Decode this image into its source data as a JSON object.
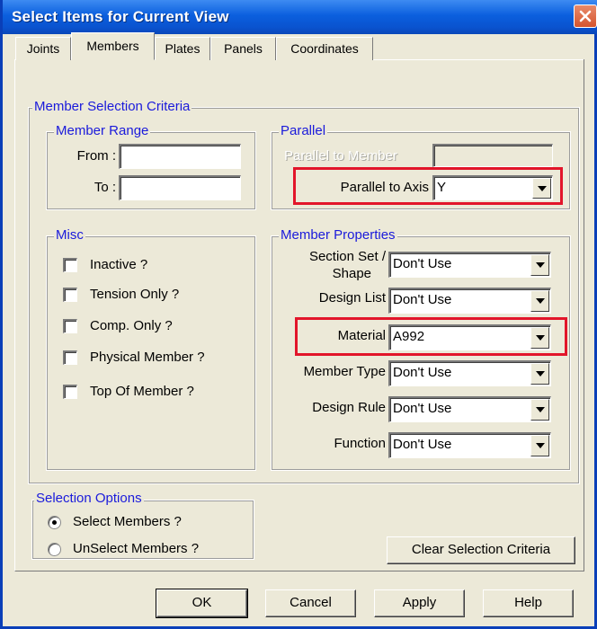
{
  "window": {
    "title": "Select Items for Current View"
  },
  "tabs": [
    {
      "label": "Joints",
      "active": false
    },
    {
      "label": "Members",
      "active": true
    },
    {
      "label": "Plates",
      "active": false
    },
    {
      "label": "Panels",
      "active": false
    },
    {
      "label": "Coordinates",
      "active": false
    }
  ],
  "criteria": {
    "title": "Member Selection Criteria",
    "range": {
      "title": "Member Range",
      "from_label": "From :",
      "from_value": "",
      "to_label": "To :",
      "to_value": ""
    },
    "parallel": {
      "title": "Parallel",
      "member_label": "Parallel to Member",
      "member_value": "",
      "axis_label": "Parallel to Axis",
      "axis_value": "Y"
    },
    "misc": {
      "title": "Misc",
      "items": [
        {
          "label": "Inactive ?",
          "checked": false
        },
        {
          "label": "Tension Only ?",
          "checked": false
        },
        {
          "label": "Comp. Only ?",
          "checked": false
        },
        {
          "label": "Physical Member ?",
          "checked": false
        },
        {
          "label": "Top Of Member ?",
          "checked": false
        }
      ]
    },
    "props": {
      "title": "Member Properties",
      "section_label_1": "Section Set /",
      "section_label_2": "Shape",
      "section_value": "Don't Use",
      "design_list_label": "Design List",
      "design_list_value": "Don't Use",
      "material_label": "Material",
      "material_value": "A992",
      "member_type_label": "Member Type",
      "member_type_value": "Don't Use",
      "design_rule_label": "Design Rule",
      "design_rule_value": "Don't Use",
      "function_label": "Function",
      "function_value": "Don't Use"
    }
  },
  "selection": {
    "title": "Selection Options",
    "select_label": "Select Members ?",
    "select_checked": true,
    "unselect_label": "UnSelect Members ?",
    "unselect_checked": false
  },
  "buttons": {
    "clear": "Clear Selection Criteria",
    "ok": "OK",
    "cancel": "Cancel",
    "apply": "Apply",
    "help": "Help"
  },
  "colors": {
    "highlight": "#e2152a",
    "group_label": "#1a1adb",
    "titlebar": "#0a53cf",
    "dialog_bg": "#ece9d8"
  }
}
